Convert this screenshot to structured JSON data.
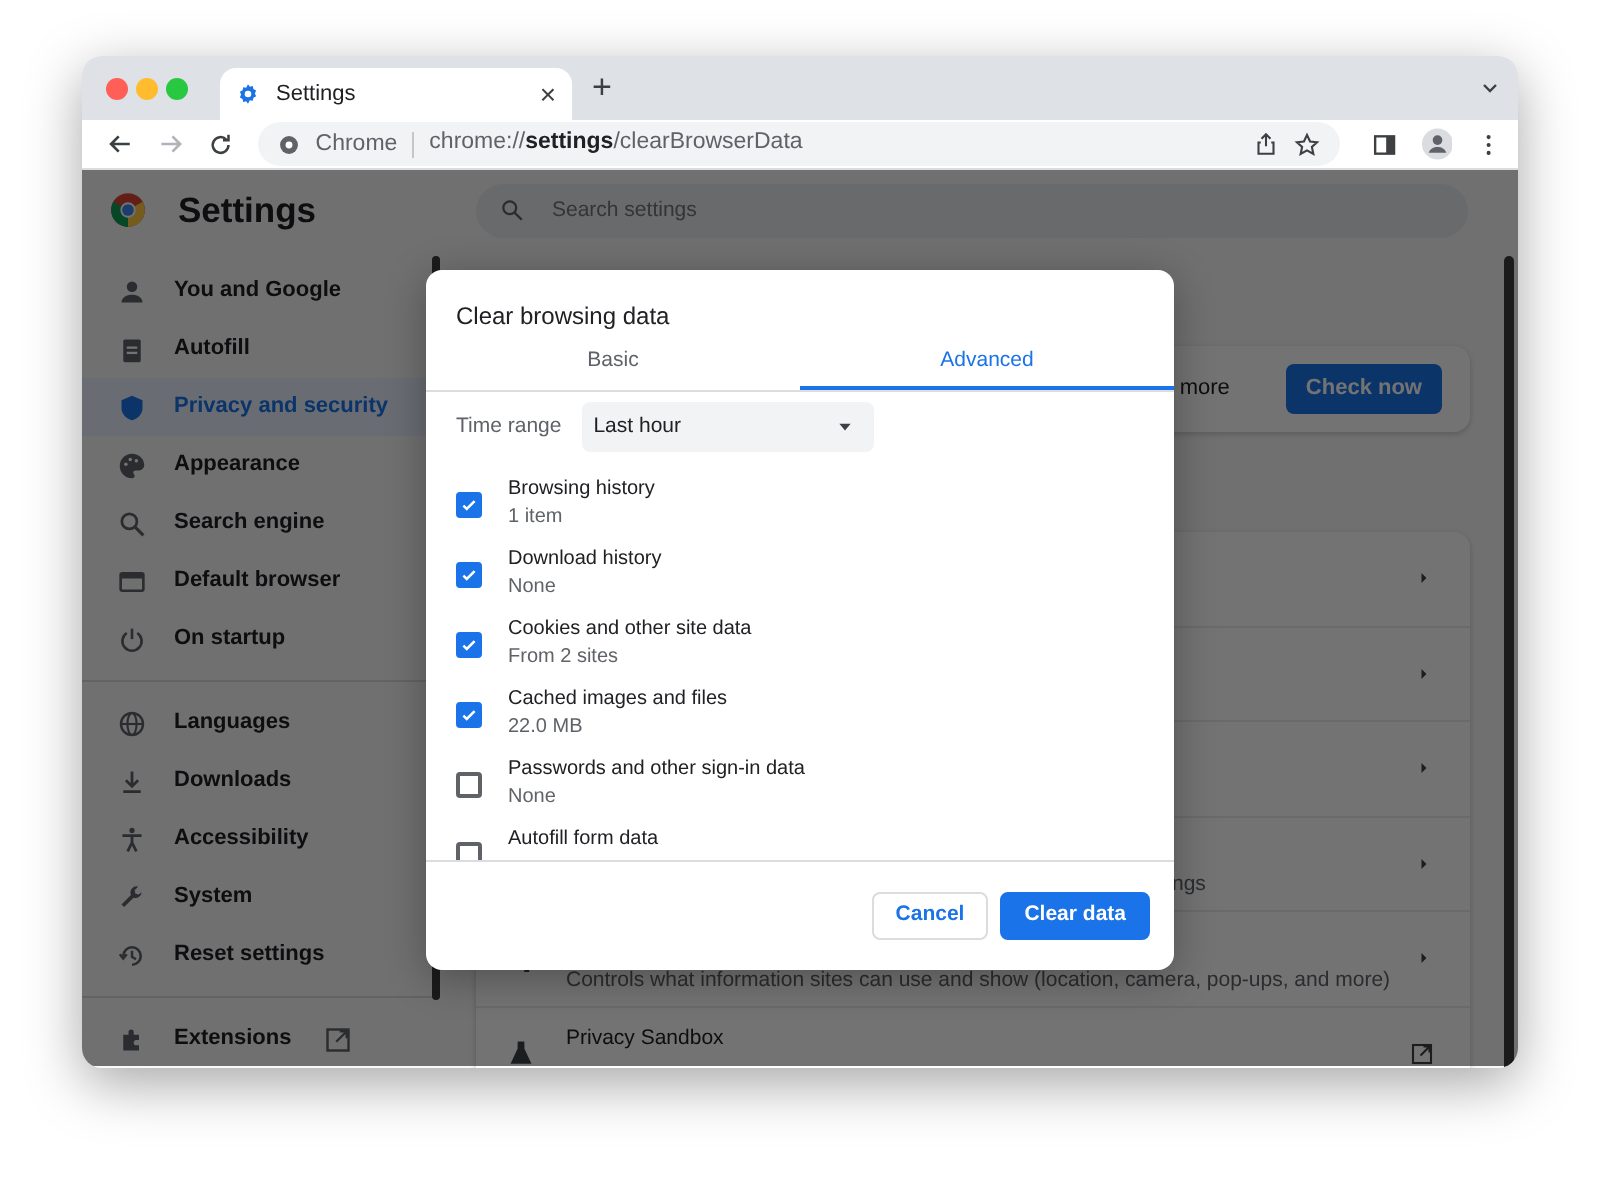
{
  "browser": {
    "tab": {
      "title": "Settings",
      "close": "×"
    },
    "new_tab": "+",
    "address": {
      "origin": "Chrome",
      "url": "chrome://**settings**/clearBrowserData"
    }
  },
  "settings": {
    "title": "Settings",
    "search": {
      "placeholder": "Search settings"
    },
    "sidebar": {
      "groups": [
        {
          "items": [
            {
              "label": "You and Google",
              "selected": false
            },
            {
              "label": "Autofill",
              "selected": false
            },
            {
              "label": "Privacy and security",
              "selected": true
            },
            {
              "label": "Appearance",
              "selected": false
            },
            {
              "label": "Search engine",
              "selected": false
            },
            {
              "label": "Default browser",
              "selected": false
            },
            {
              "label": "On startup",
              "selected": false
            }
          ]
        },
        {
          "items": [
            {
              "label": "Languages",
              "selected": false
            },
            {
              "label": "Downloads",
              "selected": false
            },
            {
              "label": "Accessibility",
              "selected": false
            },
            {
              "label": "System",
              "selected": false
            },
            {
              "label": "Reset settings",
              "selected": false
            }
          ]
        },
        {
          "items": [
            {
              "label": "Extensions",
              "selected": false
            }
          ]
        }
      ]
    },
    "safety_check": {
      "text": "more",
      "button": "Check now"
    },
    "rows": [
      {
        "kind": "submenu"
      },
      {
        "kind": "submenu"
      },
      {
        "kind": "submenu"
      },
      {
        "kind": "submenu",
        "description": "ngs"
      },
      {
        "kind": "submenu",
        "description": "Controls what information sites can use and show (location, camera, pop-ups, and more)"
      },
      {
        "kind": "external",
        "title": "Privacy Sandbox"
      }
    ]
  },
  "dialog": {
    "title": "Clear browsing data",
    "tabs": [
      {
        "label": "Basic",
        "selected": false
      },
      {
        "label": "Advanced",
        "selected": true
      }
    ],
    "time_range": {
      "label": "Time range",
      "value": "Last hour"
    },
    "options": [
      {
        "label": "Browsing history",
        "detail": "1 item",
        "checked": true
      },
      {
        "label": "Download history",
        "detail": "None",
        "checked": true
      },
      {
        "label": "Cookies and other site data",
        "detail": "From 2 sites",
        "checked": true
      },
      {
        "label": "Cached images and files",
        "detail": "22.0 MB",
        "checked": true
      },
      {
        "label": "Passwords and other sign-in data",
        "detail": "None",
        "checked": false
      },
      {
        "label": "Autofill form data",
        "checked": false
      }
    ],
    "buttons": [
      {
        "label": "Cancel",
        "kind": "secondary"
      },
      {
        "label": "Clear data",
        "kind": "primary"
      }
    ]
  }
}
